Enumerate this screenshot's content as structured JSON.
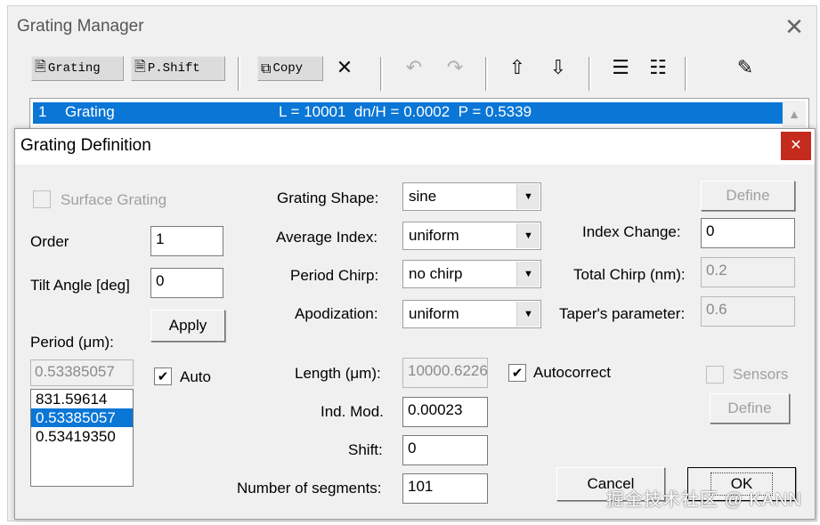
{
  "manager": {
    "title": "Grating Manager",
    "toolbar": {
      "grating_label": "Grating",
      "pshift_label": "P.Shift",
      "copy_label": "Copy"
    },
    "list": {
      "index": "1",
      "name": "Grating",
      "details": "L = 10001  dn/H = 0.0002  P = 0.5339"
    }
  },
  "dialog": {
    "title": "Grating Definition",
    "surface_grating_label": "Surface Grating",
    "order_label": "Order",
    "order_value": "1",
    "tilt_label": "Tilt Angle [deg]",
    "tilt_value": "0",
    "apply_label": "Apply",
    "period_label": "Period (μm):",
    "period_value": "0.53385057",
    "auto_label": "Auto",
    "period_list": [
      "831.59614",
      "0.53385057",
      "0.53419350"
    ],
    "period_list_selected": 1,
    "grating_shape_label": "Grating Shape:",
    "grating_shape_value": "sine",
    "average_index_label": "Average Index:",
    "average_index_value": "uniform",
    "period_chirp_label": "Period Chirp:",
    "period_chirp_value": "no chirp",
    "apodization_label": "Apodization:",
    "apodization_value": "uniform",
    "length_label": "Length (μm):",
    "length_value": "10000.6226",
    "autocorrect_label": "Autocorrect",
    "ind_mod_label": "Ind. Mod.",
    "ind_mod_value": "0.00023",
    "shift_label": "Shift:",
    "shift_value": "0",
    "segments_label": "Number of segments:",
    "segments_value": "101",
    "define_label": "Define",
    "index_change_label": "Index Change:",
    "index_change_value": "0",
    "total_chirp_label": "Total Chirp (nm):",
    "total_chirp_value": "0.2",
    "taper_label": "Taper's parameter:",
    "taper_value": "0.6",
    "sensors_label": "Sensors",
    "define2_label": "Define",
    "cancel_label": "Cancel",
    "ok_label": "OK"
  },
  "watermark": "掘金技术社区 @ KANN",
  "colors": {
    "selection": "#0a76d6",
    "close_red": "#c42b1c",
    "dialog_bg": "#f0f0f0"
  }
}
